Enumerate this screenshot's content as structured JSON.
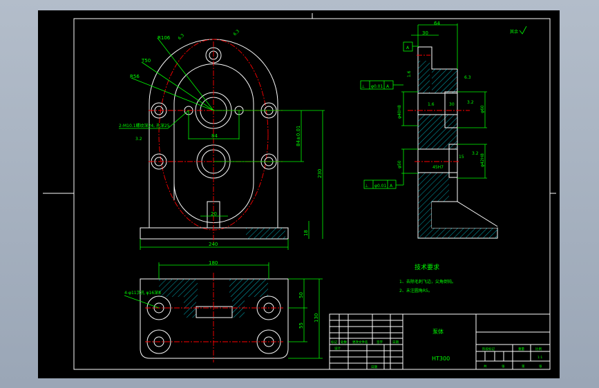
{
  "drawing": {
    "colors": {
      "background": "#000000",
      "outline": "#ffffff",
      "dimension": "#00ff00",
      "centerline": "#ff0000",
      "hatch": "#00ffff"
    },
    "front_view": {
      "leaders": [
        "R106",
        "T50",
        "R56"
      ],
      "hole_note": "2-M10.1螺纹深24, 孔深25",
      "roughness_top": [
        "6.3",
        "6.3"
      ],
      "roughness_left": "3.2",
      "dims": {
        "hole_spacing": "84",
        "center_distance": "84±0.01",
        "height": "230",
        "neck": "20",
        "width": "240",
        "base": "18"
      }
    },
    "top_view": {
      "hole_note": "4-φ11沉孔 φ16深8",
      "dims": {
        "width": "180",
        "d1": "50",
        "d2": "55",
        "height": "130"
      }
    },
    "side_view": {
      "dims": {
        "total": "64",
        "top": "30",
        "datum_a": "A",
        "r1": "1.6",
        "r2": "6.3",
        "bore1": "φ40H8",
        "bore2": "φ60",
        "depth": "30",
        "r3": "3.2",
        "r4": "1.6",
        "r5": "3.2",
        "depth2": "15",
        "bore3": "φ42H8",
        "thread": "45H7",
        "bore4": "φ50"
      },
      "tolerances": [
        {
          "symbol": "⊥",
          "value": "φ0.01",
          "datum": "A"
        },
        {
          "symbol": "⊥",
          "value": "φ0.01",
          "datum": "A"
        }
      ],
      "other_roughness": "其余"
    },
    "tech_requirements": {
      "title": "技术要求",
      "items": [
        "1、去除毛刺飞边，尖角倒钝。",
        "2、未注圆角R5。"
      ]
    },
    "title_block": {
      "part_name": "泵体",
      "material": "HT300",
      "headers": [
        "标记",
        "处数",
        "更改文件名",
        "签字",
        "日期"
      ],
      "design": "设计",
      "approve_date": "日期",
      "right_headers": [
        "阶段标记",
        "重量",
        "比例"
      ],
      "scale": "1:1",
      "sheets": [
        "共",
        "张",
        "第",
        "张"
      ]
    }
  }
}
